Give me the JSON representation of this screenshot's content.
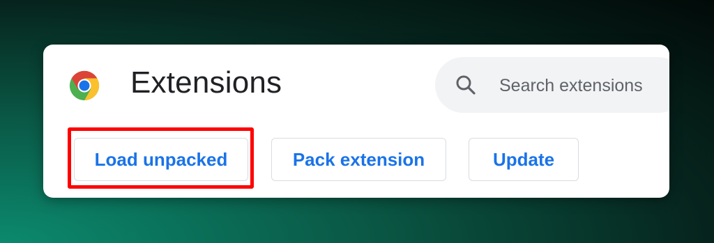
{
  "page": {
    "title": "Extensions",
    "logo_icon": "chrome-logo-icon"
  },
  "search": {
    "placeholder": "Search extensions",
    "icon": "search-icon"
  },
  "toolbar": {
    "load_unpacked_label": "Load unpacked",
    "pack_extension_label": "Pack extension",
    "update_label": "Update"
  },
  "colors": {
    "accent": "#1a73e8",
    "highlight": "#ff0000",
    "title_text": "#202124"
  }
}
